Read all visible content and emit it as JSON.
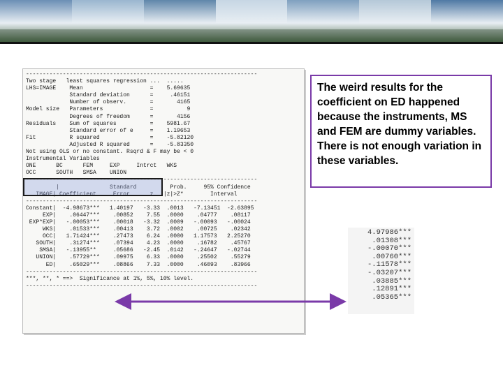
{
  "banner": {
    "colors": [
      "#6b8fb5",
      "#9ab6cf",
      "#5f86aa",
      "#c6d6e4",
      "#7fa0bf",
      "#b5c8d8",
      "#4f79a4"
    ]
  },
  "stata_output": {
    "lines": [
      "---------------------------------------------------------------------",
      "Two stage   least squares regression ...  .....",
      "LHS=IMAGE    Mean                    =    5.69635",
      "             Standard deviation      =     .46151",
      "             Number of observ.       =       4165",
      "Model size   Parameters              =          9",
      "             Degrees of freedom      =       4156",
      "Residuals    Sum of squares          =    5981.67",
      "             Standard error of e     =    1.19653",
      "Fit          R squared               =    -5.82120",
      "             Adjusted R squared      =    -5.83350",
      "Not using OLS or no constant. Rsqrd & F may be < 0",
      "Instrumental Variables",
      "ONE      BC      FEM     EXP     Intrct   WKS",
      "OCC      SOUTH   SMSA    UNION",
      "---------------------------------------------------------------------",
      "         |               Standard          Prob.     95% Confidence",
      "   IMAGE| Coefficient     Error      z   |z|>Z*        Interval",
      "---------------------------------------------------------------------",
      "Constant|  -4.98673***   1.40197   -3.33  .0013   -7.13451  -2.63895",
      "     EXP|    .06447***    .00852    7.55  .0000    .04777    .08117",
      " EXP*EXP|   -.00053***    .00018   -3.32  .0009   -.00093   -.00024",
      "     WKS|    .01533***    .00413    3.72  .0002    .00725    .02342",
      "     OCC|   1.71424***    .27473    6.24  .0000   1.17573   2.25270",
      "   SOUTH|    .31274***    .07394    4.23  .0000    .16782    .45767",
      "    SMSA|   -.13955**     .05686   -2.45  .0142   -.24647   -.02744",
      "   UNION|    .57729***    .09975    6.33  .0000    .25502    .55279",
      "      ED|    .65029***    .08866    7.33  .0000    .46093    .83966",
      "---------------------------------------------------------------------",
      "***, **, * ==>  Significance at 1%, 5%, 10% level.",
      "---------------------------------------------------------------------"
    ]
  },
  "explanation": {
    "text": "The weird results for the coefficient on ED happened because the instruments, MS and FEM are dummy variables.  There is not enough variation in these variables."
  },
  "comparison_coefficients": [
    "4.97986***",
    ".01308***",
    "-.00070***",
    ".00760***",
    "-.11578***",
    "-.03207***",
    ".03885***",
    ".12891***",
    ".05365***"
  ],
  "colors": {
    "box_border": "#7a3aa8",
    "arrow": "#7a3aa8"
  }
}
